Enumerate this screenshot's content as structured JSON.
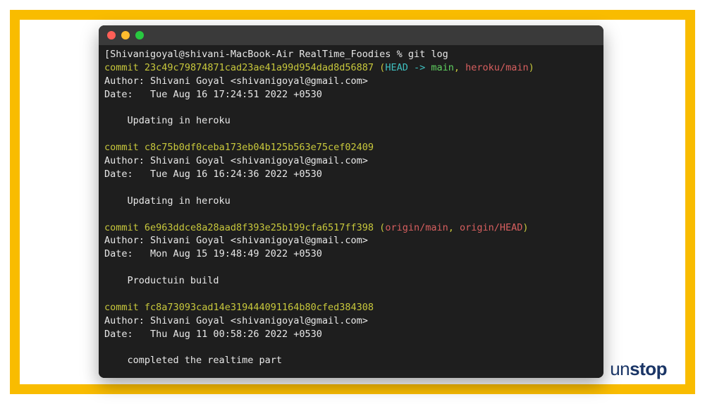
{
  "prompt": {
    "user_host": "Shivanigoyal@shivani-MacBook-Air",
    "cwd": "RealTime_Foodies",
    "symbol": "%",
    "command": "git log"
  },
  "commits": [
    {
      "commit_word": "commit",
      "hash": "23c49c79874871cad23ae41a99d954dad8d56887",
      "refs": {
        "open": "(",
        "head": "HEAD",
        "arrow": "->",
        "main": "main",
        "comma1": ",",
        "remote1": "heroku/main",
        "close": ")"
      },
      "author_label": "Author:",
      "author_value": "Shivani Goyal <shivanigoyal@gmail.com>",
      "date_label": "Date:",
      "date_value": "Tue Aug 16 17:24:51 2022 +0530",
      "message": "Updating in heroku"
    },
    {
      "commit_word": "commit",
      "hash": "c8c75b0df0ceba173eb04b125b563e75cef02409",
      "author_label": "Author:",
      "author_value": "Shivani Goyal <shivanigoyal@gmail.com>",
      "date_label": "Date:",
      "date_value": "Tue Aug 16 16:24:36 2022 +0530",
      "message": "Updating in heroku"
    },
    {
      "commit_word": "commit",
      "hash": "6e963ddce8a28aad8f393e25b199cfa6517ff398",
      "refs_remote": {
        "open": "(",
        "remote1": "origin/main",
        "comma": ",",
        "remote2": "origin/HEAD",
        "close": ")"
      },
      "author_label": "Author:",
      "author_value": "Shivani Goyal <shivanigoyal@gmail.com>",
      "date_label": "Date:",
      "date_value": "Mon Aug 15 19:48:49 2022 +0530",
      "message": "Productuin build"
    },
    {
      "commit_word": "commit",
      "hash": "fc8a73093cad14e319444091164b80cfed384308",
      "author_label": "Author:",
      "author_value": "Shivani Goyal <shivanigoyal@gmail.com>",
      "date_label": "Date:",
      "date_value": "Thu Aug 11 00:58:26 2022 +0530",
      "message": "completed the realtime part"
    }
  ],
  "brand": {
    "part1": "un",
    "part2": "stop"
  }
}
